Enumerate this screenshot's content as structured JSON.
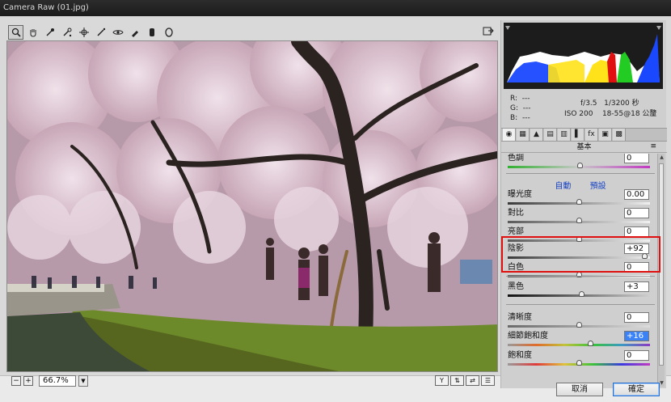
{
  "window": {
    "title": "Camera Raw (01.jpg)"
  },
  "toolbar": {
    "tools": [
      {
        "name": "zoom-tool",
        "glyph": "🔍"
      },
      {
        "name": "hand-tool",
        "glyph": "✋"
      },
      {
        "name": "white-balance-tool",
        "glyph": "✎"
      },
      {
        "name": "color-sampler-tool",
        "glyph": "✒"
      },
      {
        "name": "targeted-adjustment-tool",
        "glyph": "⊕"
      },
      {
        "name": "crop-tool",
        "glyph": "⌗"
      },
      {
        "name": "straighten-tool",
        "glyph": "⟋"
      },
      {
        "name": "spot-removal-tool",
        "glyph": "✂"
      },
      {
        "name": "red-eye-tool",
        "glyph": "⊙"
      },
      {
        "name": "adjustment-brush-tool",
        "glyph": "✐"
      },
      {
        "name": "graduated-filter-tool",
        "glyph": "▮"
      },
      {
        "name": "radial-filter-tool",
        "glyph": "◎"
      }
    ]
  },
  "statusbar": {
    "zoom_out": "−",
    "zoom_in": "+",
    "zoom": "66.7%"
  },
  "info": {
    "r_label": "R:",
    "r_value": "---",
    "g_label": "G:",
    "g_value": "---",
    "b_label": "B:",
    "b_value": "---",
    "aperture": "f/3.5",
    "shutter": "1/3200 秒",
    "iso": "ISO 200",
    "lens": "18-55@18 公釐"
  },
  "panel": {
    "section_title": "基本",
    "menu_glyph": "≡",
    "tabs": [
      "◉",
      "▦",
      "▲",
      "▤",
      "▥",
      "▌",
      "fx",
      "▣",
      "▩"
    ],
    "temp_label": "色調",
    "temp_value": "0",
    "auto_link": "自動",
    "default_link": "預設",
    "sliders": [
      {
        "label": "曝光度",
        "value": "0.00",
        "level": 0.5
      },
      {
        "label": "對比",
        "value": "0",
        "level": 0.5
      },
      {
        "label": "亮部",
        "value": "0",
        "level": 0.5
      },
      {
        "label": "陰影",
        "value": "+92",
        "level": 0.96
      },
      {
        "label": "白色",
        "value": "0",
        "level": 0.5
      },
      {
        "label": "黑色",
        "value": "+3",
        "level": 0.515
      },
      {
        "label": "清晰度",
        "value": "0",
        "level": 0.5
      },
      {
        "label": "細節飽和度",
        "value": "+16",
        "level": 0.58
      },
      {
        "label": "飽和度",
        "value": "0",
        "level": 0.5
      }
    ]
  },
  "buttons": {
    "cancel": "取消",
    "ok": "確定"
  },
  "colors": {
    "highlight": "#e01010",
    "link": "#1a44c4",
    "selected_value_bg": "#3b82f6"
  }
}
